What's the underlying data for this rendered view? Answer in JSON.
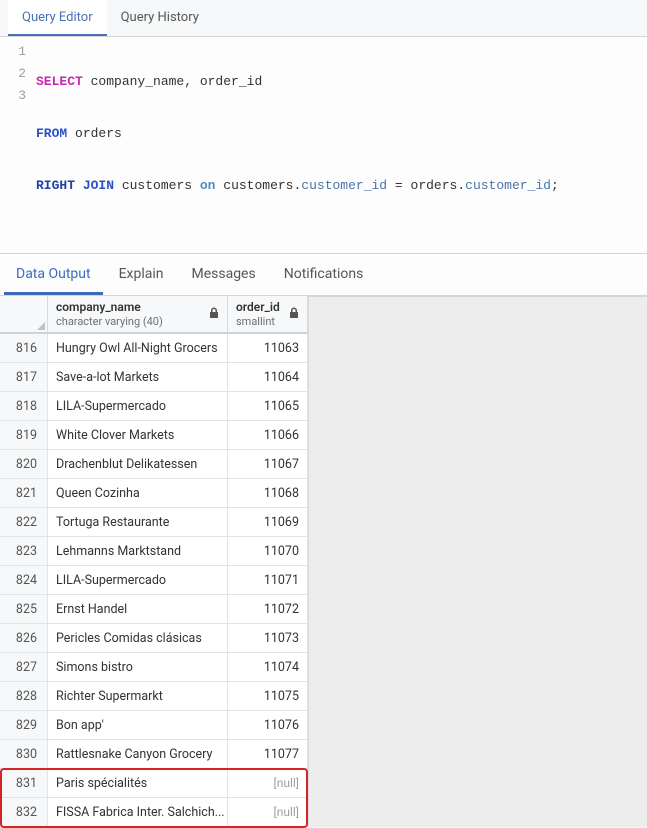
{
  "top_tabs": {
    "editor": "Query Editor",
    "history": "Query History"
  },
  "sql": {
    "line1": {
      "select": "SELECT",
      "cols": " company_name, order_id"
    },
    "line2": {
      "from": "FROM",
      "table": " orders"
    },
    "line3": {
      "right": "RIGHT ",
      "join": "JOIN",
      "t1": " customers ",
      "on": "on",
      "sp1": " customers.",
      "f1": "customer_id",
      "eq": " = orders.",
      "f2": "customer_id",
      "semi": ";"
    },
    "linenums": {
      "l1": "1",
      "l2": "2",
      "l3": "3"
    }
  },
  "result_tabs": {
    "data": "Data Output",
    "explain": "Explain",
    "messages": "Messages",
    "notifications": "Notifications"
  },
  "columns": {
    "col1_name": "company_name",
    "col1_type": "character varying (40)",
    "col2_name": "order_id",
    "col2_type": "smallint"
  },
  "rows": [
    {
      "n": "816",
      "company": "Hungry Owl All-Night Grocers",
      "order": "11063"
    },
    {
      "n": "817",
      "company": "Save-a-lot Markets",
      "order": "11064"
    },
    {
      "n": "818",
      "company": "LILA-Supermercado",
      "order": "11065"
    },
    {
      "n": "819",
      "company": "White Clover Markets",
      "order": "11066"
    },
    {
      "n": "820",
      "company": "Drachenblut Delikatessen",
      "order": "11067"
    },
    {
      "n": "821",
      "company": "Queen Cozinha",
      "order": "11068"
    },
    {
      "n": "822",
      "company": "Tortuga Restaurante",
      "order": "11069"
    },
    {
      "n": "823",
      "company": "Lehmanns Marktstand",
      "order": "11070"
    },
    {
      "n": "824",
      "company": "LILA-Supermercado",
      "order": "11071"
    },
    {
      "n": "825",
      "company": "Ernst Handel",
      "order": "11072"
    },
    {
      "n": "826",
      "company": "Pericles Comidas clásicas",
      "order": "11073"
    },
    {
      "n": "827",
      "company": "Simons bistro",
      "order": "11074"
    },
    {
      "n": "828",
      "company": "Richter Supermarkt",
      "order": "11075"
    },
    {
      "n": "829",
      "company": "Bon app'",
      "order": "11076"
    },
    {
      "n": "830",
      "company": "Rattlesnake Canyon Grocery",
      "order": "11077"
    },
    {
      "n": "831",
      "company": "Paris spécialités",
      "order": "[null]",
      "null": true
    },
    {
      "n": "832",
      "company": "FISSA Fabrica Inter. Salchich...",
      "order": "[null]",
      "null": true
    }
  ],
  "colors": {
    "accent": "#3d6ab8",
    "highlight": "#d42424"
  }
}
